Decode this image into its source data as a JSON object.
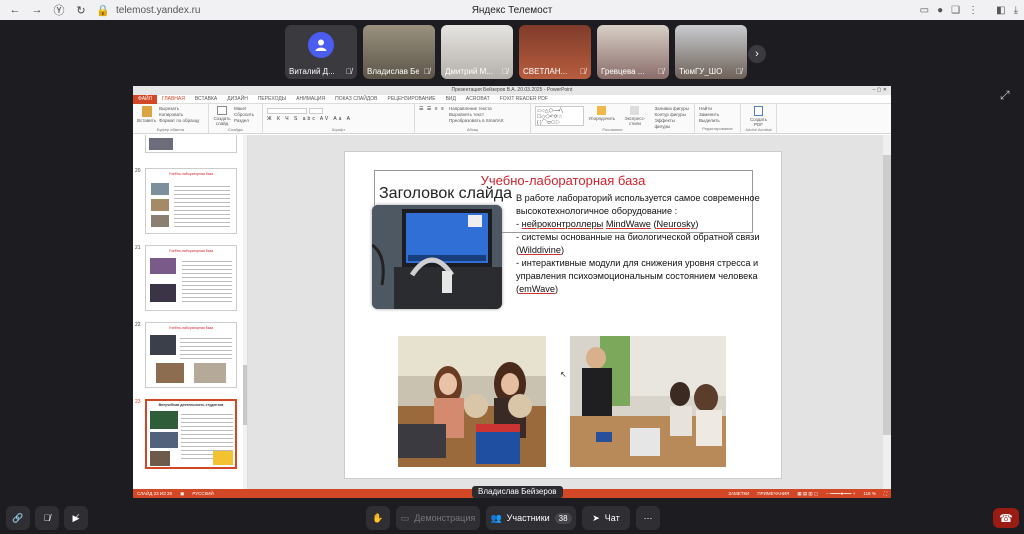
{
  "browser": {
    "url": "telemost.yandex.ru",
    "title": "Яндекс Телемост"
  },
  "participants": [
    {
      "name": "Виталий Д..."
    },
    {
      "name": "Владислав Бе..."
    },
    {
      "name": "Дмитрий М..."
    },
    {
      "name": "СВЕТЛАН..."
    },
    {
      "name": "Гревцева ..."
    },
    {
      "name": "ТюмГУ_ШО"
    }
  ],
  "ppt": {
    "window_title": "Презентация Бейзеров В.А. 20.03.2025 - PowerPoint",
    "tabs": [
      "ФАЙЛ",
      "ГЛАВНАЯ",
      "ВСТАВКА",
      "ДИЗАЙН",
      "ПЕРЕХОДЫ",
      "АНИМАЦИЯ",
      "ПОКАЗ СЛАЙДОВ",
      "РЕЦЕНЗИРОВАНИЕ",
      "ВИД",
      "ACROBAT",
      "FOXIT READER PDF"
    ],
    "ribbon_groups": [
      {
        "name": "Буфер обмена",
        "items": [
          "Вставить",
          "Вырезать",
          "Копировать",
          "Формат по образцу"
        ]
      },
      {
        "name": "Слайды",
        "items": [
          "Создать слайд",
          "Макет",
          "Сбросить",
          "Раздел"
        ]
      },
      {
        "name": "Шрифт",
        "items": []
      },
      {
        "name": "Абзац",
        "items": [
          "Направление текста",
          "Выровнять текст",
          "Преобразовать в SmartArt"
        ]
      },
      {
        "name": "Рисование",
        "items": [
          "Упорядочить",
          "Экспресс-стили",
          "Заливка фигуры",
          "Контур фигуры",
          "Эффекты фигуры"
        ]
      },
      {
        "name": "Редактирование",
        "items": [
          "Найти",
          "Заменить",
          "Выделить"
        ]
      },
      {
        "name": "Adobe Acrobat",
        "items": [
          "Создать PDF"
        ]
      }
    ],
    "thumb_numbers": [
      "20",
      "21",
      "22",
      "23"
    ],
    "thumb_titles": [
      "Учебно-лабораторная база",
      "Учебно-лабораторная база",
      "Учебно-лабораторная база",
      "Внеучебная деятельность студентов"
    ],
    "status_left": "СЛАЙД 23 ИЗ 28",
    "status_lang": "РУССКИЙ",
    "status_notes": "ЗАМЕТКИ",
    "status_comments": "ПРИМЕЧАНИЯ",
    "zoom": "116 %"
  },
  "slide": {
    "heading": "Учебно-лабораторная база",
    "ghost_title": "Заголовок слайда",
    "body_line1": "В работе  лабораторий используется  самое современное высокотехнологичное оборудование :",
    "b1_prefix": " - ",
    "b1_link1": "нейроконтроллеры",
    "b1_mid": "  ",
    "b1_link2": "MindWawe",
    "b1_paren": " (",
    "b1_link3": "Neurosky",
    "b1_end": ")",
    "b2_text": " - системы основанные на биологической обратной связи (",
    "b2_link": "Wilddivine",
    "b2_end": ")",
    "b3_text": "- интерактивные модули для снижения уровня стресса и управления психоэмоциональным состоянием человека (",
    "b3_link": "emWave",
    "b3_end": ")"
  },
  "speaker_label": "Владислав Бейзеров",
  "toolbar": {
    "demo": "Демонстрация",
    "participants": "Участники",
    "participants_count": "38",
    "chat": "Чат"
  }
}
